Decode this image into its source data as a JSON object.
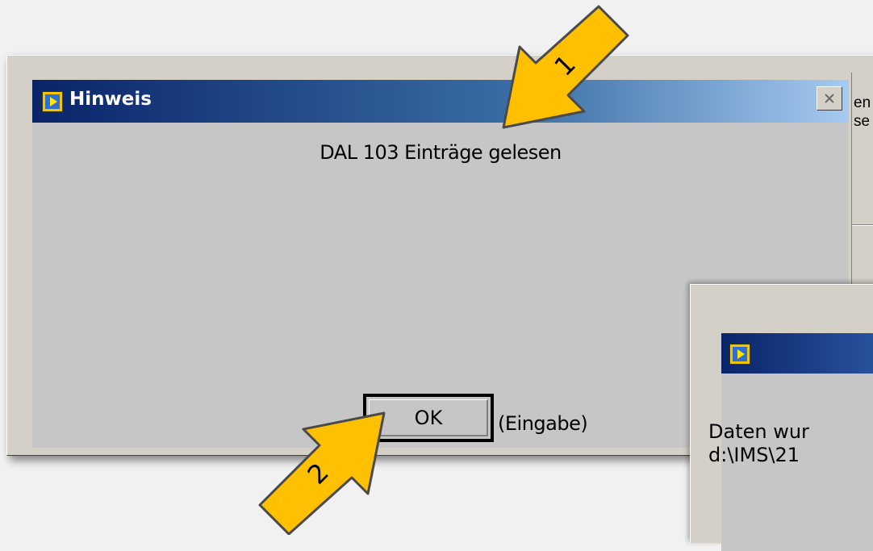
{
  "background_window": {
    "partial_text_line1": "en",
    "partial_text_line2": "se"
  },
  "dialog": {
    "title": "Hinweis",
    "message": "DAL 103 Einträge gelesen",
    "ok_button_label": "OK",
    "shortcut_hint": "(Eingabe)"
  },
  "second_dialog": {
    "text_line1": "Daten wur",
    "text_line2": "d:\\IMS\\21"
  },
  "annotations": {
    "arrow1_label": "1",
    "arrow2_label": "2",
    "arrow_color": "#ffc000"
  },
  "colors": {
    "titlebar_start": "#0a246a",
    "titlebar_end": "#a6caf0",
    "dialog_face": "#c6c6c6"
  },
  "icons": [
    "app-icon",
    "close-icon"
  ]
}
